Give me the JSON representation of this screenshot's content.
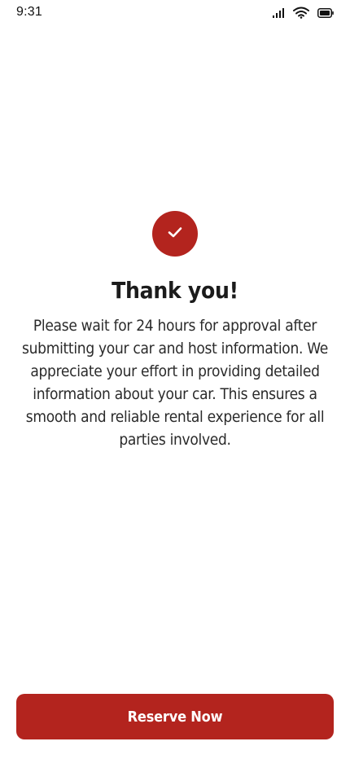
{
  "status_bar": {
    "time": "9:31",
    "icons": [
      "signal-icon",
      "wifi-icon",
      "battery-icon"
    ]
  },
  "confirmation": {
    "icon": "check-icon",
    "title": "Thank you!",
    "message": "Please wait for 24 hours for approval after submitting your car and host information. We appreciate your effort in providing detailed information about your car. This ensures a smooth and reliable rental experience for all parties involved."
  },
  "actions": {
    "reserve_label": "Reserve Now"
  },
  "colors": {
    "accent": "#b3241e",
    "background": "#ffffff",
    "text": "#1e1e1e"
  }
}
